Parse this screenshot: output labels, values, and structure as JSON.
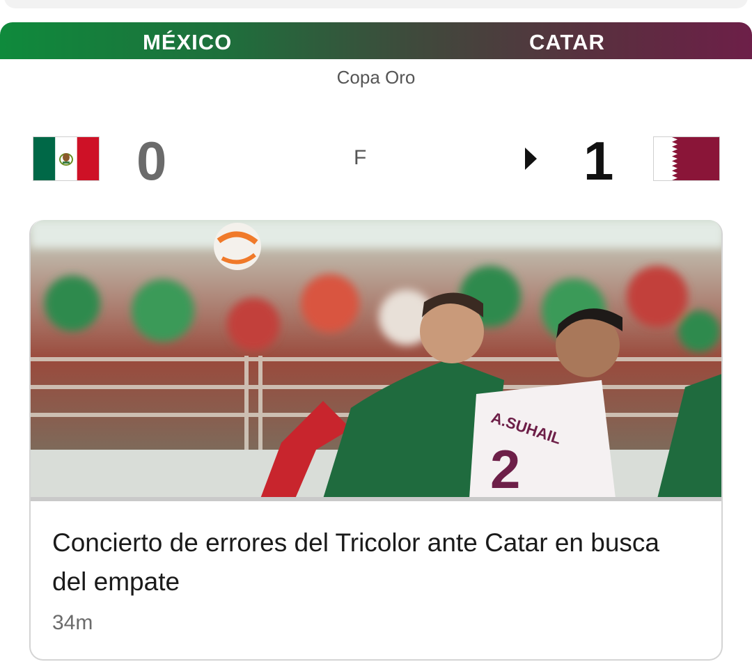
{
  "match": {
    "home_team": "MÉXICO",
    "away_team": "CATAR",
    "competition": "Copa Oro",
    "home_score": "0",
    "away_score": "1",
    "status": "F",
    "home_flag_icon": "mexico-flag-icon",
    "away_flag_icon": "qatar-flag-icon",
    "winner_indicator_icon": "triangle-right-icon"
  },
  "news": {
    "headline": "Concierto de errores del Tricolor ante Catar en busca del empate",
    "time_ago": "34m",
    "image": "photo of a Mexico player and Qatar player #2 A. Suhail contesting the ball in front of a crowd"
  },
  "colors": {
    "banner_start": "#0f8a3c",
    "banner_end": "#6d1f48",
    "mexico_green": "#006847",
    "mexico_red": "#ce1126",
    "qatar_maroon": "#8a1538"
  }
}
